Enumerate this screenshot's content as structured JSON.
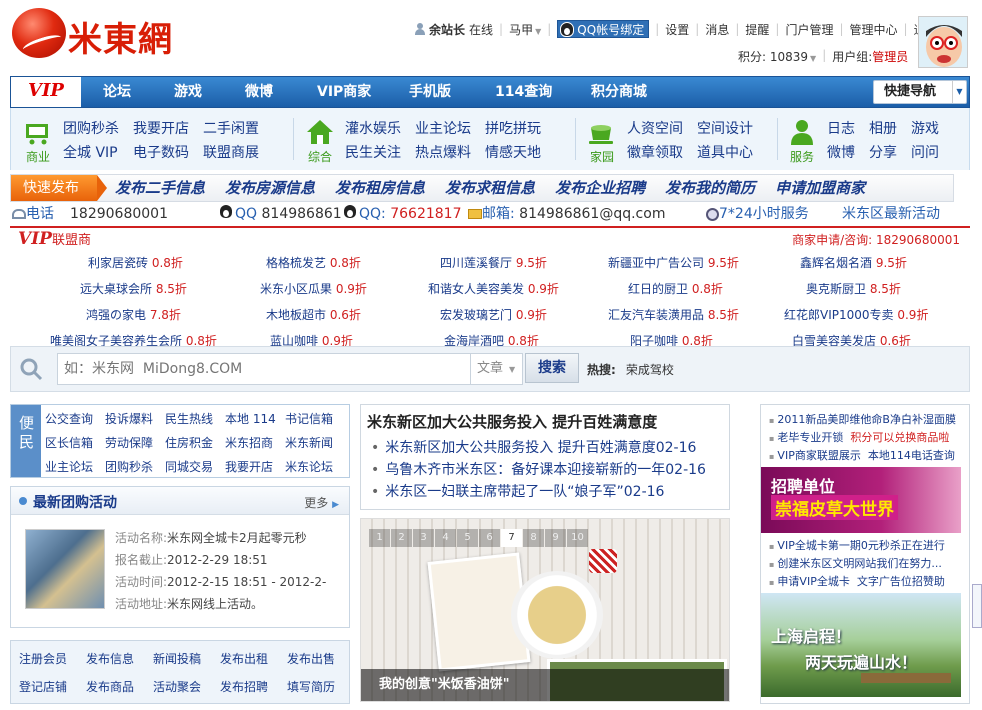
{
  "logo": {
    "text": "米東網"
  },
  "userbar": {
    "username": "余站长",
    "status": "在线",
    "status2": "马甲",
    "qq_bind": "QQ帐号绑定",
    "links": [
      "设置",
      "消息",
      "提醒",
      "门户管理",
      "管理中心",
      "退出"
    ]
  },
  "scorebar": {
    "score_label": "积分: 10839",
    "group_label": "用户组:",
    "group_value": "管理员"
  },
  "nav": {
    "vip": "VIP",
    "items": [
      "论坛",
      "游戏",
      "微博",
      "VIP商家",
      "手机版",
      "114查询",
      "积分商城"
    ],
    "quick": "快捷导航"
  },
  "categories": [
    {
      "label": "商业",
      "icon": "cart-icon",
      "links": [
        "团购秒杀",
        "全城 VIP",
        "我要开店",
        "电子数码",
        "二手闲置",
        "联盟商展"
      ]
    },
    {
      "label": "综合",
      "icon": "house-icon",
      "links": [
        "灌水娱乐",
        "民生关注",
        "业主论坛",
        "热点爆料",
        "拼吃拼玩",
        "情感天地"
      ]
    },
    {
      "label": "家园",
      "icon": "coffee-icon",
      "links": [
        "人资空间",
        "徽章领取",
        "空间设计",
        "道具中心"
      ]
    },
    {
      "label": "服务",
      "icon": "person-service-icon",
      "links": [
        "日志",
        "微博",
        "相册",
        "分享",
        "游戏",
        "问问"
      ]
    }
  ],
  "publish": {
    "tag": "快速发布",
    "links": [
      "发布二手信息",
      "发布房源信息",
      "发布租房信息",
      "发布求租信息",
      "发布企业招聘",
      "发布我的简历",
      "申请加盟商家"
    ]
  },
  "contact": {
    "phone_label": "电话",
    "phone": "18290680001",
    "qq1_label": "QQ",
    "qq1": "814986861",
    "qq2_label": "QQ:",
    "qq2": "76621817",
    "mail_label": "邮箱:",
    "mail": "814986861@qq.com",
    "service": "7*24小时服务",
    "latest": "米东区最新活动"
  },
  "vip_merchants": {
    "title": "VIP",
    "title_suffix": "联盟商",
    "hotline": "商家申请/咨询:   18290680001",
    "rows": [
      [
        [
          "利家居瓷砖",
          "0.8折"
        ],
        [
          "格格梳发艺",
          "0.8折"
        ],
        [
          "四川莲溪餐厅",
          "9.5折"
        ],
        [
          "新疆亚中广告公司",
          "9.5折"
        ],
        [
          "鑫辉名烟名酒",
          "9.5折"
        ]
      ],
      [
        [
          "远大桌球会所",
          "8.5折"
        ],
        [
          "米东小区瓜果",
          "0.9折"
        ],
        [
          "和谐女人美容美发",
          "0.9折"
        ],
        [
          "红日的厨卫",
          "0.8折"
        ],
        [
          "奥克斯厨卫",
          "8.5折"
        ]
      ],
      [
        [
          "鸿强の家电",
          "7.8折"
        ],
        [
          "木地板超市",
          "0.6折"
        ],
        [
          "宏发玻璃艺门",
          "0.9折"
        ],
        [
          "汇友汽车装潢用品",
          "8.5折"
        ],
        [
          "红花郎VIP1000专卖",
          "0.9折"
        ]
      ],
      [
        [
          "唯美阁女子美容养生会所",
          "0.8折"
        ],
        [
          "蓝山咖啡",
          "0.9折"
        ],
        [
          "金海岸酒吧",
          "0.8折"
        ],
        [
          "阳子咖啡",
          "0.8折"
        ],
        [
          "白雪美容美发店",
          "0.6折"
        ]
      ]
    ]
  },
  "search": {
    "placeholder": "如：米东网  MiDong8.COM",
    "type": "文章",
    "button": "搜索",
    "hot_label": "热搜:",
    "hot_word": "荣成驾校"
  },
  "bianmin": {
    "tag": "便民",
    "links": [
      "公交查询",
      "投诉爆料",
      "民生热线",
      "本地 114",
      "书记信箱",
      "区长信箱",
      "劳动保障",
      "住房积金",
      "米东招商",
      "米东新闻",
      "业主论坛",
      "团购秒杀",
      "同城交易",
      "我要开店",
      "米东论坛"
    ]
  },
  "tuangou": {
    "title": "最新团购活动",
    "more": "更多",
    "fields": [
      [
        "活动名称:",
        "米东网全城卡2月起零元秒"
      ],
      [
        "报名截止:",
        "2012-2-29 18:51"
      ],
      [
        "活动时间:",
        "2012-2-15 18:51 - 2012-2-"
      ],
      [
        "活动地址:",
        "米东网线上活动。"
      ]
    ]
  },
  "reglinks": [
    "注册会员",
    "发布信息",
    "新闻投稿",
    "发布出租",
    "发布出售",
    "登记店铺",
    "发布商品",
    "活动聚会",
    "发布招聘",
    "填写简历"
  ],
  "news": {
    "headline": "米东新区加大公共服务投入 提升百姓满意度",
    "items": [
      "米东新区加大公共服务投入 提升百姓满意度02-16",
      "乌鲁木齐市米东区：备好课本迎接崭新的一年02-16",
      "米东区一妇联主席带起了一队“娘子军”02-16"
    ]
  },
  "slider": {
    "pages": [
      "1",
      "2",
      "3",
      "4",
      "5",
      "6",
      "7",
      "8",
      "9",
      "10"
    ],
    "active_page": "7",
    "caption": "我的创意\"米饭香油饼\""
  },
  "right": {
    "links_top": [
      "2011新品美即维他命B净白补湿面膜",
      "老毕专业开锁",
      "积分可以兑换商品啦",
      "VIP商家联盟展示",
      "本地114电话查询"
    ],
    "ad1_line1": "招聘单位",
    "ad1_line2": "崇福皮草大世界",
    "links_mid": [
      "VIP全城卡第一期0元秒杀正在进行",
      "创建米东区文明网站我们在努力...",
      "申请VIP全城卡",
      "文字广告位招赞助"
    ],
    "ad2_line1": "上海启程！",
    "ad2_line2": "两天玩遍山水！"
  }
}
